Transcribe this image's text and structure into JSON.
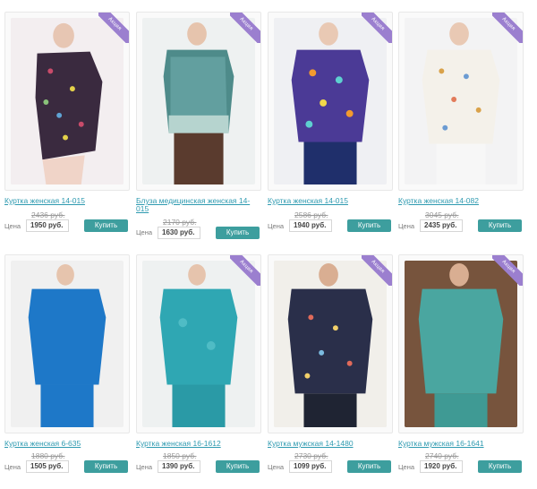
{
  "price_label": "Цена",
  "buy_label": "Купить",
  "promo_label": "Акция",
  "colors": {
    "link": "#2e9ab0",
    "button": "#3d9e9e",
    "promo": "#9b7fcf"
  },
  "products": [
    {
      "title": "Куртка женская 14-015",
      "old_price": "2436 руб.",
      "price": "1950 руб.",
      "promo": true
    },
    {
      "title": "Блуза медицинская женская 14-015",
      "old_price": "2170 руб.",
      "price": "1630 руб.",
      "promo": true
    },
    {
      "title": "Куртка женская 14-015",
      "old_price": "2586 руб.",
      "price": "1940 руб.",
      "promo": true
    },
    {
      "title": "Куртка женская 14-082",
      "old_price": "3045 руб.",
      "price": "2435 руб.",
      "promo": true
    },
    {
      "title": "Куртка женская 6-635",
      "old_price": "1880 руб.",
      "price": "1505 руб.",
      "promo": false
    },
    {
      "title": "Куртка женская 16-1612",
      "old_price": "1850 руб.",
      "price": "1390 руб.",
      "promo": true
    },
    {
      "title": "Куртка мужская 14-1480",
      "old_price": "2730 руб.",
      "price": "1099 руб.",
      "promo": true
    },
    {
      "title": "Куртка мужская 16-1641",
      "old_price": "2740 руб.",
      "price": "1920 руб.",
      "promo": true
    }
  ]
}
